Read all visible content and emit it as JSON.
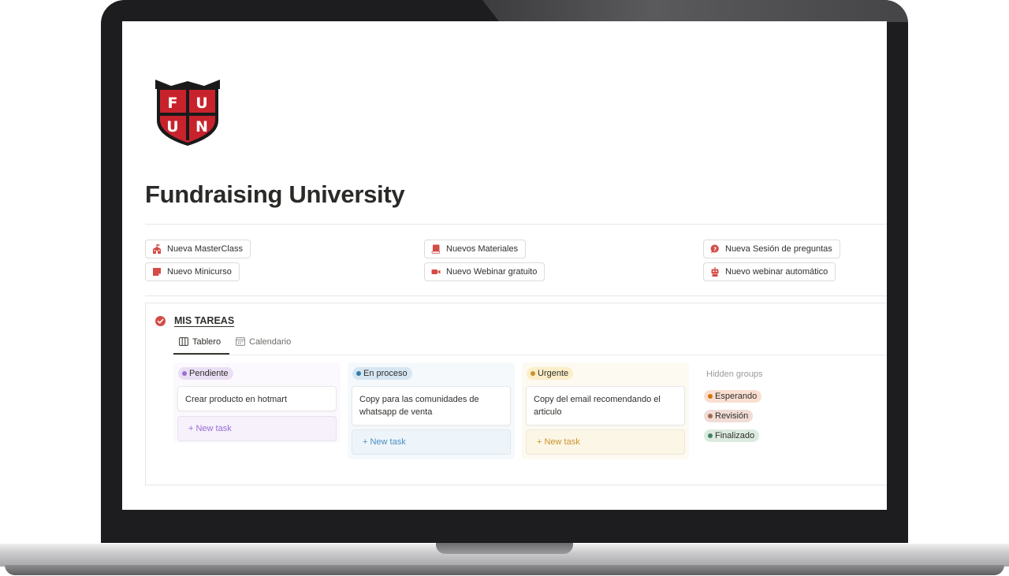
{
  "page": {
    "title": "Fundraising University",
    "logo": {
      "icon": "fuun-shield-logo",
      "letters": [
        "F",
        "U",
        "U",
        "N"
      ],
      "color": "#c8232c"
    }
  },
  "links": [
    {
      "label": "Nueva MasterClass",
      "icon": "school-icon"
    },
    {
      "label": "Nuevos Materiales",
      "icon": "book-icon"
    },
    {
      "label": "Nueva Sesión de preguntas",
      "icon": "chat-question-icon"
    },
    {
      "label": "Nuevo Minicurso",
      "icon": "sticky-note-icon"
    },
    {
      "label": "Nuevo Webinar gratuito",
      "icon": "video-camera-icon"
    },
    {
      "label": "Nuevo webinar automático",
      "icon": "robot-icon"
    }
  ],
  "database": {
    "title": "MIS TAREAS",
    "views": [
      {
        "label": "Tablero",
        "icon": "board-icon",
        "active": true
      },
      {
        "label": "Calendario",
        "icon": "calendar-icon",
        "active": false
      }
    ],
    "columns": [
      {
        "label": "Pendiente",
        "dot": "#9a6dd7",
        "badge_bg": "#eadff5",
        "col_bg": "#fbf9fd",
        "new_color": "#9a6dd7",
        "cards": [
          "Crear producto en hotmart"
        ],
        "new_task": "+ New task"
      },
      {
        "label": "En proceso",
        "dot": "#337ea9",
        "badge_bg": "#d6e6f2",
        "col_bg": "#f5f9fc",
        "new_color": "#4a8ec2",
        "cards": [
          "Copy para las comunidades de whatsapp de venta"
        ],
        "new_task": "+ New task"
      },
      {
        "label": "Urgente",
        "dot": "#cb912f",
        "badge_bg": "#fbeec9",
        "col_bg": "#fdfaf2",
        "new_color": "#cb912f",
        "cards": [
          "Copy del email recomendando el articulo"
        ],
        "new_task": "+ New task"
      }
    ],
    "hidden_groups": {
      "label": "Hidden groups",
      "items": [
        {
          "label": "Esperando",
          "dot": "#d9730d",
          "bg": "#fadfd1"
        },
        {
          "label": "Revisión",
          "dot": "#9f6b53",
          "bg": "#f1dcd6"
        },
        {
          "label": "Finalizado",
          "dot": "#448361",
          "bg": "#dcebe0"
        }
      ]
    }
  },
  "colors": {
    "accent_red": "#d44c47",
    "frame": "#1d1d1f"
  }
}
